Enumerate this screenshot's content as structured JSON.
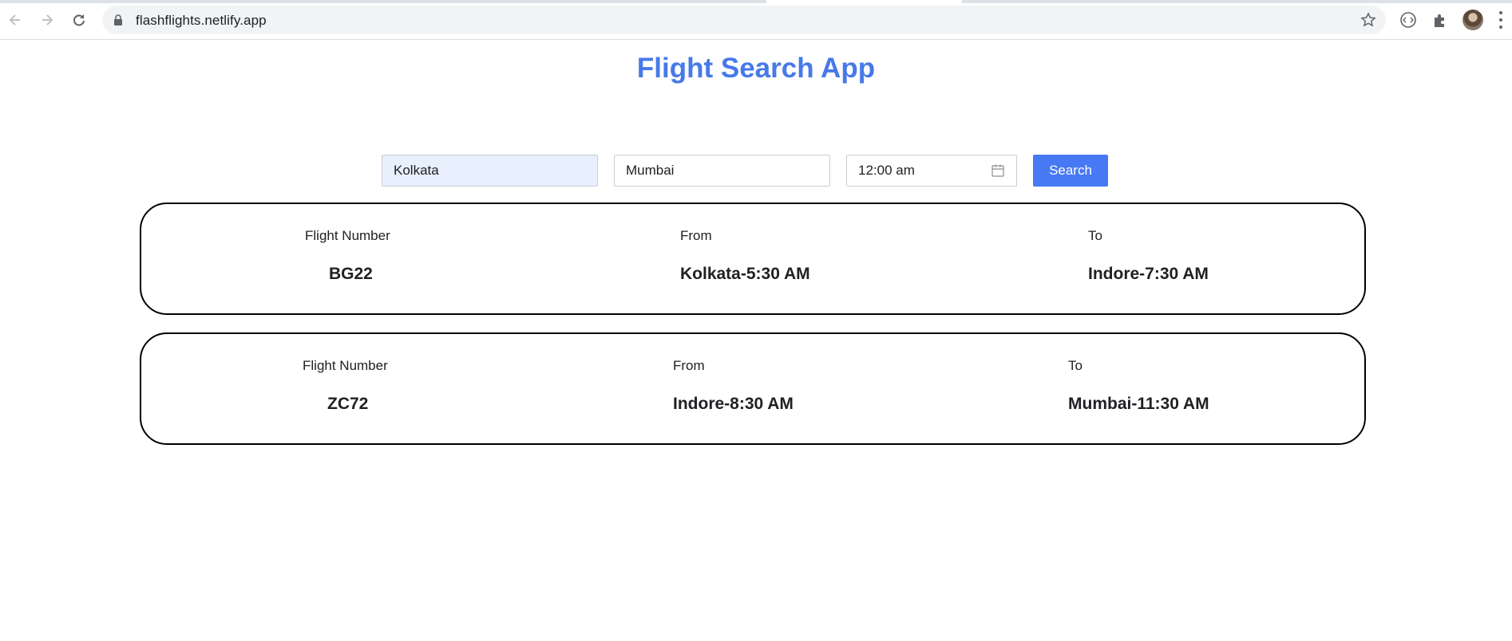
{
  "browser": {
    "url": "flashflights.netlify.app",
    "icons": {
      "back": "back-arrow-icon",
      "forward": "forward-arrow-icon",
      "reload": "reload-icon",
      "lock": "lock-icon",
      "bookmark": "star-icon",
      "extension1": "code-extension-icon",
      "extensions": "puzzle-icon",
      "menu": "kebab-menu-icon"
    }
  },
  "page": {
    "title": "Flight Search App",
    "accent_color": "#4779e8"
  },
  "search": {
    "from_value": "Kolkata",
    "to_value": "Mumbai",
    "time_value": "12:00 am",
    "button_label": "Search"
  },
  "columns": {
    "flight_number_label": "Flight Number",
    "from_label": "From",
    "to_label": "To"
  },
  "results": [
    {
      "flight_number": "BG22",
      "from": "Kolkata-5:30 AM",
      "to": "Indore-7:30 AM"
    },
    {
      "flight_number": "ZC72",
      "from": "Indore-8:30 AM",
      "to": "Mumbai-11:30 AM"
    }
  ]
}
